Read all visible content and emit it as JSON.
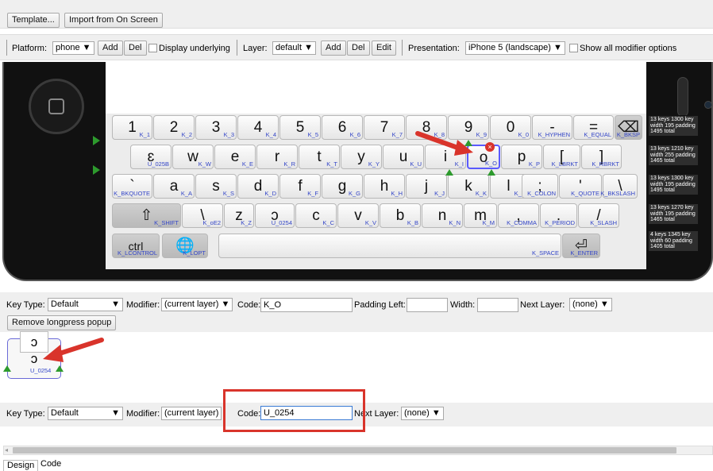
{
  "top_toolbar": {
    "template_label": "Template...",
    "import_label": "Import from On Screen"
  },
  "toolbar": {
    "platform_label": "Platform:",
    "platform_value": "phone ▼",
    "add_label": "Add",
    "del_label": "Del",
    "display_underlying_label": "Display underlying",
    "layer_label": "Layer:",
    "layer_value": "default ▼",
    "layer_add_label": "Add",
    "layer_del_label": "Del",
    "layer_edit_label": "Edit",
    "presentation_label": "Presentation:",
    "presentation_value": "iPhone 5 (landscape) ▼",
    "show_modifier_label": "Show all modifier options"
  },
  "rows": [
    {
      "keys": [
        {
          "main": "1",
          "code": "K_1"
        },
        {
          "main": "2",
          "code": "K_2"
        },
        {
          "main": "3",
          "code": "K_3"
        },
        {
          "main": "4",
          "code": "K_4"
        },
        {
          "main": "5",
          "code": "K_5"
        },
        {
          "main": "6",
          "code": "K_6"
        },
        {
          "main": "7",
          "code": "K_7"
        },
        {
          "main": "8",
          "code": "K_8"
        },
        {
          "main": "9",
          "code": "K_9"
        },
        {
          "main": "0",
          "code": "K_0"
        },
        {
          "main": "-",
          "code": "K_HYPHEN"
        },
        {
          "main": "=",
          "code": "K_EQUAL"
        },
        {
          "main": "⌫",
          "code": "K_BKSP"
        }
      ]
    },
    {
      "keys": [
        {
          "main": "ɛ",
          "code": "U_025B"
        },
        {
          "main": "w",
          "code": "K_W"
        },
        {
          "main": "e",
          "code": "K_E"
        },
        {
          "main": "r",
          "code": "K_R"
        },
        {
          "main": "t",
          "code": "K_T"
        },
        {
          "main": "y",
          "code": "K_Y"
        },
        {
          "main": "u",
          "code": "K_U"
        },
        {
          "main": "i",
          "code": "K_I"
        },
        {
          "main": "o",
          "code": "K_O"
        },
        {
          "main": "p",
          "code": "K_P"
        },
        {
          "main": "[",
          "code": "K_LBRKT"
        },
        {
          "main": "]",
          "code": "K_RBRKT"
        }
      ]
    },
    {
      "keys": [
        {
          "main": "`",
          "code": "K_BKQUOTE"
        },
        {
          "main": "a",
          "code": "K_A"
        },
        {
          "main": "s",
          "code": "K_S"
        },
        {
          "main": "d",
          "code": "K_D"
        },
        {
          "main": "f",
          "code": "K_F"
        },
        {
          "main": "g",
          "code": "K_G"
        },
        {
          "main": "h",
          "code": "K_H"
        },
        {
          "main": "j",
          "code": "K_J"
        },
        {
          "main": "k",
          "code": "K_K"
        },
        {
          "main": "l",
          "code": "K_L"
        },
        {
          "main": ";",
          "code": "K_COLON"
        },
        {
          "main": "'",
          "code": "K_QUOTE"
        },
        {
          "main": "\\",
          "code": "K_BKSLASH"
        }
      ]
    },
    {
      "keys": [
        {
          "main": "⇧",
          "code": "K_SHIFT"
        },
        {
          "main": "\\",
          "code": "K_oE2"
        },
        {
          "main": "z",
          "code": "K_Z"
        },
        {
          "main": "ɔ",
          "code": "U_0254"
        },
        {
          "main": "c",
          "code": "K_C"
        },
        {
          "main": "v",
          "code": "K_V"
        },
        {
          "main": "b",
          "code": "K_B"
        },
        {
          "main": "n",
          "code": "K_N"
        },
        {
          "main": "m",
          "code": "K_M"
        },
        {
          "main": ",",
          "code": "K_COMMA"
        },
        {
          "main": ".",
          "code": "K_PERIOD"
        },
        {
          "main": "/",
          "code": "K_SLASH"
        }
      ]
    },
    {
      "keys": [
        {
          "main": "ctrl",
          "code": "K_LCONTROL"
        },
        {
          "main": "🌐",
          "code": "K_LOPT"
        },
        {
          "main": "",
          "code": "K_SPACE"
        },
        {
          "main": "⏎",
          "code": "K_ENTER"
        }
      ]
    }
  ],
  "row_info": [
    "13 keys 1300 key width 195 padding 1495 total",
    "13 keys 1210 key width 255 padding 1465 total",
    "13 keys 1300 key width 195 padding 1495 total",
    "13 keys 1270 key width 195 padding 1465 total",
    "4 keys 1345 key width 60 padding 1405 total"
  ],
  "key_props": {
    "key_type_label": "Key Type:",
    "key_type_value": "Default",
    "modifier_label": "Modifier:",
    "modifier_value": "(current layer) ▼",
    "code_label": "Code:",
    "code_value": "K_O",
    "padding_left_label": "Padding Left:",
    "width_label": "Width:",
    "next_layer_label": "Next Layer:",
    "next_layer_value": "(none) ▼",
    "remove_popup_label": "Remove longpress popup"
  },
  "popup": {
    "top_char": "ɔ",
    "main_char": "ɔ",
    "code": "U_0254"
  },
  "sub_props": {
    "key_type_label": "Key Type:",
    "key_type_value": "Default",
    "modifier_label": "Modifier:",
    "modifier_value": "(current layer)",
    "code_label": "Code:",
    "code_value": "U_0254",
    "next_layer_label": "Next Layer:",
    "next_layer_value": "(none) ▼"
  },
  "tabs": {
    "design": "Design",
    "code": "Code"
  },
  "colors": {
    "accent_red": "#d9342b",
    "key_code_blue": "#3446c8",
    "green_tip": "#2d9a2d"
  }
}
